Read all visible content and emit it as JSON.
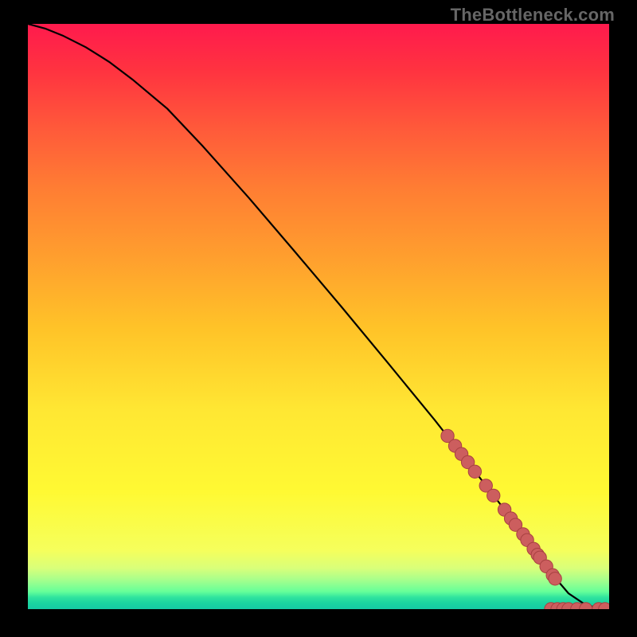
{
  "watermark": "TheBottleneck.com",
  "colors": {
    "background": "#000000",
    "curve": "#000000",
    "marker_fill": "#cc5e5e",
    "marker_stroke": "#a84141",
    "gradient_top": "#ff1a4d",
    "gradient_bottom": "#16caa4"
  },
  "chart_data": {
    "type": "line",
    "title": "",
    "xlabel": "",
    "ylabel": "",
    "xlim": [
      0,
      100
    ],
    "ylim": [
      0,
      100
    ],
    "curve": {
      "x": [
        0,
        3,
        6,
        10,
        14,
        18,
        24,
        30,
        38,
        46,
        54,
        62,
        70,
        76,
        82,
        87,
        90,
        93,
        96,
        99,
        100
      ],
      "y": [
        100,
        99.2,
        98,
        96,
        93.5,
        90.5,
        85.5,
        79.2,
        70.3,
        61,
        51.6,
        42,
        32.3,
        24.7,
        17,
        10.3,
        6.2,
        2.7,
        0.7,
        0,
        0
      ]
    },
    "markers": [
      {
        "x": 72.2,
        "y": 29.6
      },
      {
        "x": 73.5,
        "y": 27.9
      },
      {
        "x": 74.6,
        "y": 26.5
      },
      {
        "x": 75.7,
        "y": 25.1
      },
      {
        "x": 76.9,
        "y": 23.5
      },
      {
        "x": 78.8,
        "y": 21.1
      },
      {
        "x": 80.1,
        "y": 19.4
      },
      {
        "x": 82.0,
        "y": 17.0
      },
      {
        "x": 83.1,
        "y": 15.5
      },
      {
        "x": 83.9,
        "y": 14.4
      },
      {
        "x": 85.2,
        "y": 12.8
      },
      {
        "x": 85.9,
        "y": 11.8
      },
      {
        "x": 87.0,
        "y": 10.3
      },
      {
        "x": 87.7,
        "y": 9.3
      },
      {
        "x": 88.1,
        "y": 8.8
      },
      {
        "x": 89.2,
        "y": 7.3
      },
      {
        "x": 90.3,
        "y": 5.8
      },
      {
        "x": 90.7,
        "y": 5.2
      },
      {
        "x": 90.0,
        "y": 0.0,
        "on_axis": true
      },
      {
        "x": 91.1,
        "y": 0.0,
        "on_axis": true
      },
      {
        "x": 92.1,
        "y": 0.0,
        "on_axis": true
      },
      {
        "x": 93.0,
        "y": 0.0,
        "on_axis": true
      },
      {
        "x": 94.5,
        "y": 0.0,
        "on_axis": true
      },
      {
        "x": 96.0,
        "y": 0.0,
        "on_axis": true
      },
      {
        "x": 98.2,
        "y": 0.0,
        "on_axis": true
      },
      {
        "x": 99.3,
        "y": 0.0,
        "on_axis": true
      }
    ]
  }
}
